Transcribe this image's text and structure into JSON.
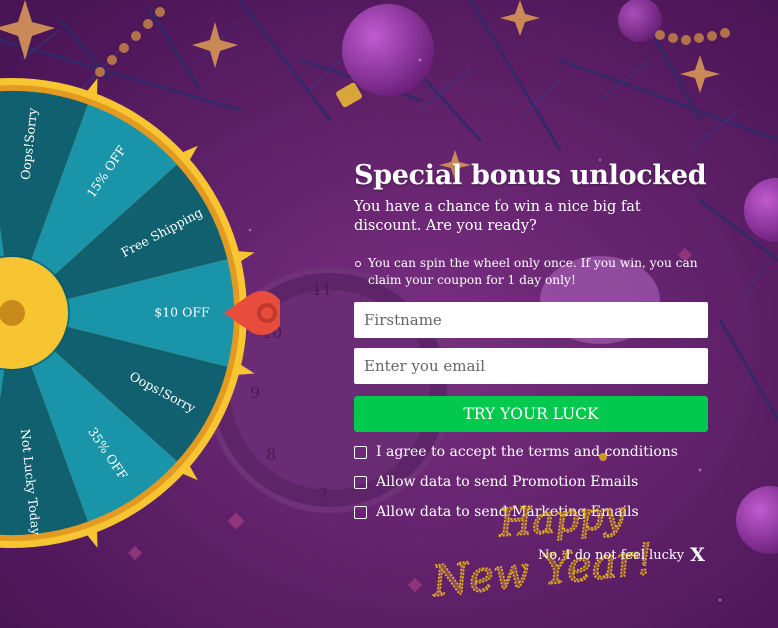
{
  "popup": {
    "title": "Special bonus unlocked",
    "subtitle": "You have a chance to win a nice big fat discount. Are you ready?",
    "rules": [
      "You can spin the wheel only once. If you win, you can claim your coupon for 1 day only!"
    ],
    "firstname": {
      "placeholder": "Firstname",
      "value": ""
    },
    "email": {
      "placeholder": "Enter you email",
      "value": ""
    },
    "submit_label": "TRY YOUR LUCK",
    "checkboxes": [
      {
        "label": "I agree to accept the terms and conditions",
        "checked": false
      },
      {
        "label": "Allow data to send Promotion Emails",
        "checked": false
      },
      {
        "label": "Allow data to send Marketing Emails",
        "checked": false
      }
    ],
    "decline_label": "No, I do not feel lucky",
    "close_glyph": "X"
  },
  "wheel": {
    "segments": [
      "Oops!Sorry",
      "15% OFF",
      "Free Shipping",
      "$10 OFF",
      "Oops!Sorry",
      "35% OFF",
      "Not Lucky Today"
    ],
    "pointer_icon": "map-pin-icon"
  },
  "greeting": {
    "line1": "Happy",
    "line2": "New Year!"
  },
  "colors": {
    "background": "#5a1f63",
    "wheel_rim": "#f7c531",
    "wheel_teal_light": "#1a94a8",
    "wheel_teal_dark": "#10606f",
    "pointer": "#e74c3c",
    "button": "#00c94e",
    "greeting_gold": "#e6b317"
  }
}
